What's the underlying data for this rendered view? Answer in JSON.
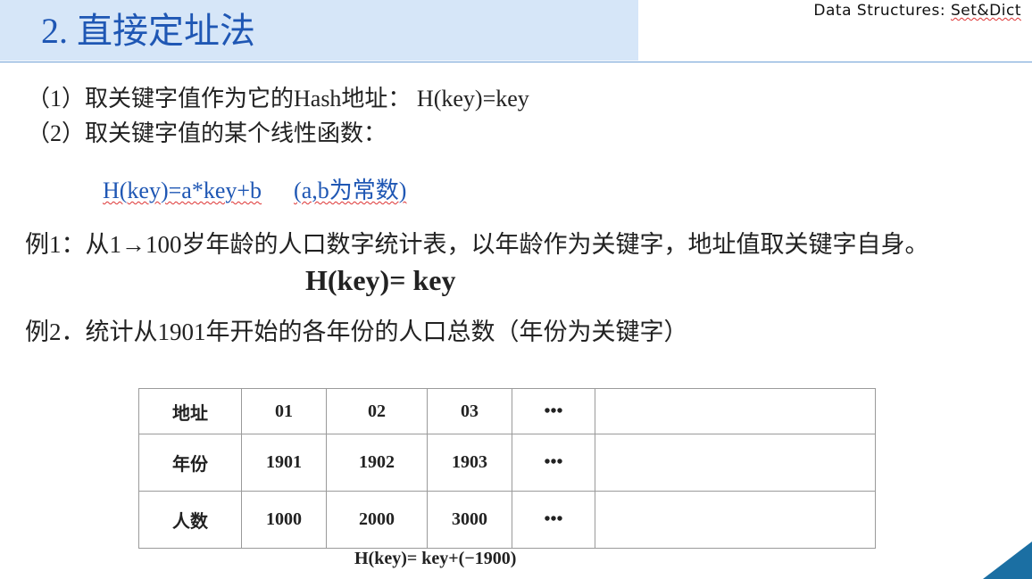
{
  "header": {
    "title": "2. 直接定址法",
    "course_prefix": "Data  Structures: ",
    "course_topic": "Set&Dict"
  },
  "content": {
    "line1": "（1）取关键字值作为它的Hash地址：   H(key)=key",
    "line2": "（2）取关键字值的某个线性函数：",
    "linear_formula": "H(key)=a*key+b",
    "linear_note": "(a,b为常数)",
    "example1": "例1：从1→100岁年龄的人口数字统计表，以年龄作为关键字，地址值取关键字自身。",
    "example1_formula": "H(key)= key",
    "example2": "例2．统计从1901年开始的各年份的人口总数（年份为关键字）"
  },
  "table": {
    "rows": [
      [
        "地址",
        "01",
        "02",
        "03",
        "•••",
        ""
      ],
      [
        "年份",
        "1901",
        "1902",
        "1903",
        "•••",
        ""
      ],
      [
        "人数",
        "1000",
        "2000",
        "3000",
        "•••",
        ""
      ]
    ]
  },
  "bottom_formula": "H(key)= key+(−1900)",
  "colors": {
    "title_band": "#d6e6f8",
    "title_text": "#1f57b4",
    "formula_blue": "#1f57b4",
    "corner_accent": "#1b6fa3"
  }
}
